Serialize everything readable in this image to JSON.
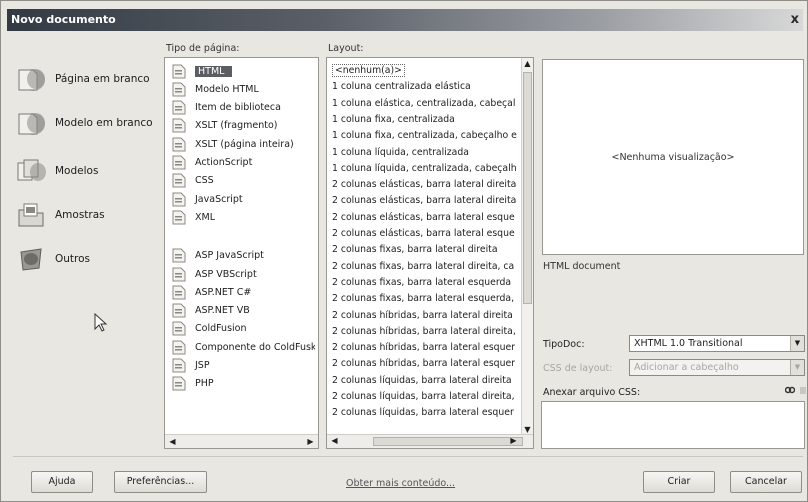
{
  "window": {
    "title": "Novo documento",
    "close_symbol": "x"
  },
  "categories": [
    {
      "label": "Página em branco",
      "icon": "blank-page-icon"
    },
    {
      "label": "Modelo em branco",
      "icon": "blank-template-icon"
    },
    {
      "label": "Modelos",
      "icon": "templates-icon"
    },
    {
      "label": "Amostras",
      "icon": "samples-icon"
    },
    {
      "label": "Outros",
      "icon": "other-icon"
    }
  ],
  "page_type": {
    "header": "Tipo de página:",
    "selected": "HTML",
    "items": [
      "HTML",
      "Modelo HTML",
      "Item de biblioteca",
      "XSLT (fragmento)",
      "XSLT (página inteira)",
      "ActionScript",
      "CSS",
      "JavaScript",
      "XML",
      "ASP JavaScript",
      "ASP VBScript",
      "ASP.NET C#",
      "ASP.NET VB",
      "ColdFusion",
      "Componente do ColdFusk",
      "JSP",
      "PHP"
    ]
  },
  "layout": {
    "header": "Layout:",
    "selected": "<nenhum(a)>",
    "items": [
      "<nenhum(a)>",
      "1 coluna centralizada elástica",
      "1 coluna elástica, centralizada, cabeçal",
      "1 coluna fixa, centralizada",
      "1 coluna fixa, centralizada, cabeçalho e",
      "1 coluna líquida, centralizada",
      "1 coluna líquida, centralizada, cabeçalh",
      "2 colunas elásticas, barra lateral direita",
      "2 colunas elásticas, barra lateral direita",
      "2 colunas elásticas, barra lateral esque",
      "2 colunas elásticas, barra lateral esque",
      "2 colunas fixas, barra lateral direita",
      "2 colunas fixas, barra lateral direita, ca",
      "2 colunas fixas, barra lateral esquerda",
      "2 colunas fixas, barra lateral esquerda,",
      "2 colunas híbridas, barra lateral direita",
      "2 colunas híbridas, barra lateral direita,",
      "2 colunas híbridas, barra lateral esquer",
      "2 colunas híbridas, barra lateral esquer",
      "2 colunas líquidas, barra lateral direita",
      "2 colunas líquidas, barra lateral direita,",
      "2 colunas líquidas, barra lateral esquer"
    ]
  },
  "preview": {
    "text": "<Nenhuma visualização>",
    "description": "HTML document"
  },
  "form": {
    "doctype_label": "TipoDoc:",
    "doctype_value": "XHTML 1.0 Transitional",
    "css_layout_label": "CSS de layout:",
    "css_layout_value": "Adicionar a cabeçalho",
    "attach_css_label": "Anexar arquivo CSS:"
  },
  "buttons": {
    "help": "Ajuda",
    "preferences": "Preferências...",
    "more_content": "Obter mais conteúdo...",
    "create": "Criar",
    "cancel": "Cancelar"
  }
}
